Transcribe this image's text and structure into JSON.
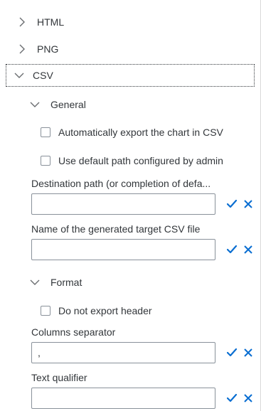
{
  "sections": {
    "html": {
      "label": "HTML",
      "expanded": false,
      "icon": "chevron-right-icon"
    },
    "png": {
      "label": "PNG",
      "expanded": false,
      "icon": "chevron-right-icon"
    },
    "csv": {
      "label": "CSV",
      "expanded": true,
      "icon": "chevron-down-icon"
    }
  },
  "general": {
    "label": "General",
    "icon": "chevron-down-icon",
    "auto_export_label": "Automatically export the chart in CSV",
    "auto_export_checked": false,
    "default_path_label": "Use default path configured by admin",
    "default_path_checked": false,
    "destination_label": "Destination path (or completion of defa...",
    "destination_value": "",
    "filename_label": "Name of the generated target CSV file",
    "filename_value": ""
  },
  "format": {
    "label": "Format",
    "icon": "chevron-down-icon",
    "no_header_label": "Do not export header",
    "no_header_checked": false,
    "separator_label": "Columns separator",
    "separator_value": ",",
    "qualifier_label": "Text qualifier",
    "qualifier_value": ""
  },
  "actions": {
    "confirm_icon": "checkmark-icon",
    "cancel_icon": "close-icon",
    "confirm_color": "#0a6ed1",
    "cancel_color": "#0a6ed1"
  }
}
